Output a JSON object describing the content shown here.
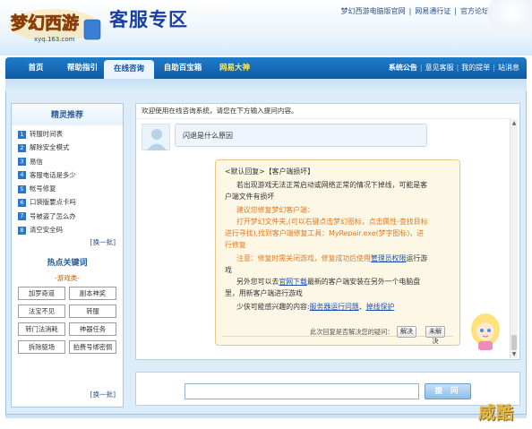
{
  "header": {
    "logo_text": "梦幻西游",
    "logo_url_text": "xyq.163.com",
    "brand": "客服专区",
    "top_links": [
      "梦幻西游电脑版官网",
      "网易通行证",
      "官方论坛"
    ],
    "top_sep": "|"
  },
  "nav": {
    "items": [
      {
        "label": "首页"
      },
      {
        "label": "帮助指引"
      },
      {
        "label": "在线咨询",
        "active": true
      },
      {
        "label": "自助百宝箱"
      },
      {
        "label": "网易大神",
        "highlight": true
      }
    ],
    "right": [
      "系统公告",
      "意见客服",
      "我的提单",
      "站消息"
    ],
    "sep": "|"
  },
  "sidebar": {
    "title": "精灵推荐",
    "items": [
      {
        "num": "1",
        "label": "转服时间表"
      },
      {
        "num": "2",
        "label": "解除安全模式"
      },
      {
        "num": "3",
        "label": "易信"
      },
      {
        "num": "4",
        "label": "客服电话是多少"
      },
      {
        "num": "5",
        "label": "帐号修复"
      },
      {
        "num": "6",
        "label": "口袋版要点卡吗"
      },
      {
        "num": "7",
        "label": "号被盗了怎么办"
      },
      {
        "num": "8",
        "label": "清空安全码"
      }
    ],
    "refresh_label": "[换一批]",
    "hot_title": "热点关键词",
    "hot_category": "-游戏类-",
    "keywords": [
      "加罗奇道",
      "副本神奖",
      "法宝不见",
      "转服",
      "转门法消耗",
      "神器任务",
      "拆除驱场",
      "拍费号绑密佩"
    ],
    "refresh_label2": "[换一批]"
  },
  "chat": {
    "welcome": "欢迎使用在线咨询系统，请您在下方输入提问内容。",
    "user_question": "闪退是什么原因",
    "reply": {
      "header": "<默认回复>【客户端损坏】",
      "p1_line1": "若出现游戏无法正常启动或网络正常的情况下掉线，可能是客",
      "p1_line2": "户端文件有损坏",
      "p2_line1": "建议您修复梦幻客户端：",
      "p2_line2": "打开梦幻文件夹,(可以右键点击梦幻图标，点击属性-查找目标",
      "p2_line3": "进行寻找),找到客户端修复工具：MyRepair.exe(梦字图标)，进",
      "p2_line4": "行修复",
      "p3_prefix": "注意：修复时需关闭游戏，修复成功后使用",
      "p3_link": "管理员权限",
      "p3_suffix": "运行游",
      "p3_line2": "戏",
      "p4_prefix": "另外您可以去",
      "p4_link": "官网下载",
      "p4_suffix": "最新的客户端安装在另外一个电脑盘",
      "p4_line2": "里，用新客户端进行游戏",
      "p5_prefix": "少侠可能感兴趣的内容:",
      "p5_link1": "服务器运行问题",
      "p5_sep": "、",
      "p5_link2": "掉线保护"
    },
    "feedback_question": "此次回复是否解决您的疑问：",
    "yes_label": "解决",
    "no_label": "未解决"
  },
  "input": {
    "value": "",
    "placeholder": "",
    "ask_label": "提 问"
  },
  "watermark": "威酷"
}
